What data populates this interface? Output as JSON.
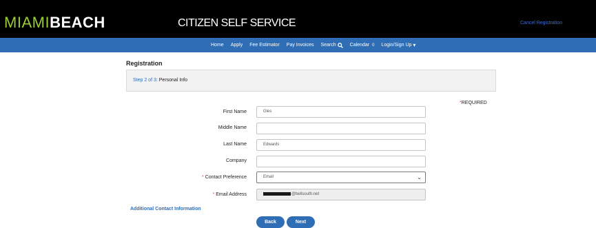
{
  "header": {
    "logo_part1": "MIAMI",
    "logo_part2": "BEACH",
    "title": "CITIZEN SELF SERVICE",
    "cancel_link": "Cancel Registration"
  },
  "nav": {
    "items": [
      {
        "label": "Home",
        "icon": ""
      },
      {
        "label": "Apply",
        "icon": ""
      },
      {
        "label": "Fee Estimator",
        "icon": ""
      },
      {
        "label": "Pay Invoices",
        "icon": ""
      },
      {
        "label": "Search",
        "icon": "search-icon"
      },
      {
        "label": "Calendar",
        "icon": "badge-0"
      },
      {
        "label": "Login/Sign Up",
        "icon": "caret-down-icon"
      }
    ],
    "calendar_count": "0"
  },
  "page": {
    "section_title": "Registration",
    "step_prefix": "Step 2 of 3:",
    "step_name": " Personal Info",
    "required_label": "REQUIRED"
  },
  "form": {
    "first_name": {
      "label": "First Name",
      "value": "Gles"
    },
    "middle_name": {
      "label": "Middle Name",
      "value": ""
    },
    "last_name": {
      "label": "Last Name",
      "value": "Edwards"
    },
    "company": {
      "label": "Company",
      "value": ""
    },
    "contact_preference": {
      "label": "Contact Preference",
      "value": "Email"
    },
    "email": {
      "label": "Email Address",
      "value_suffix": "@bellsouth.net"
    }
  },
  "links": {
    "additional_contact": "Additional Contact Information"
  },
  "buttons": {
    "back": "Back",
    "next": "Next"
  },
  "colors": {
    "nav": "#2f6db4",
    "header": "#000000",
    "logo_accent": "#9acd32",
    "required_star": "#d9534f"
  }
}
